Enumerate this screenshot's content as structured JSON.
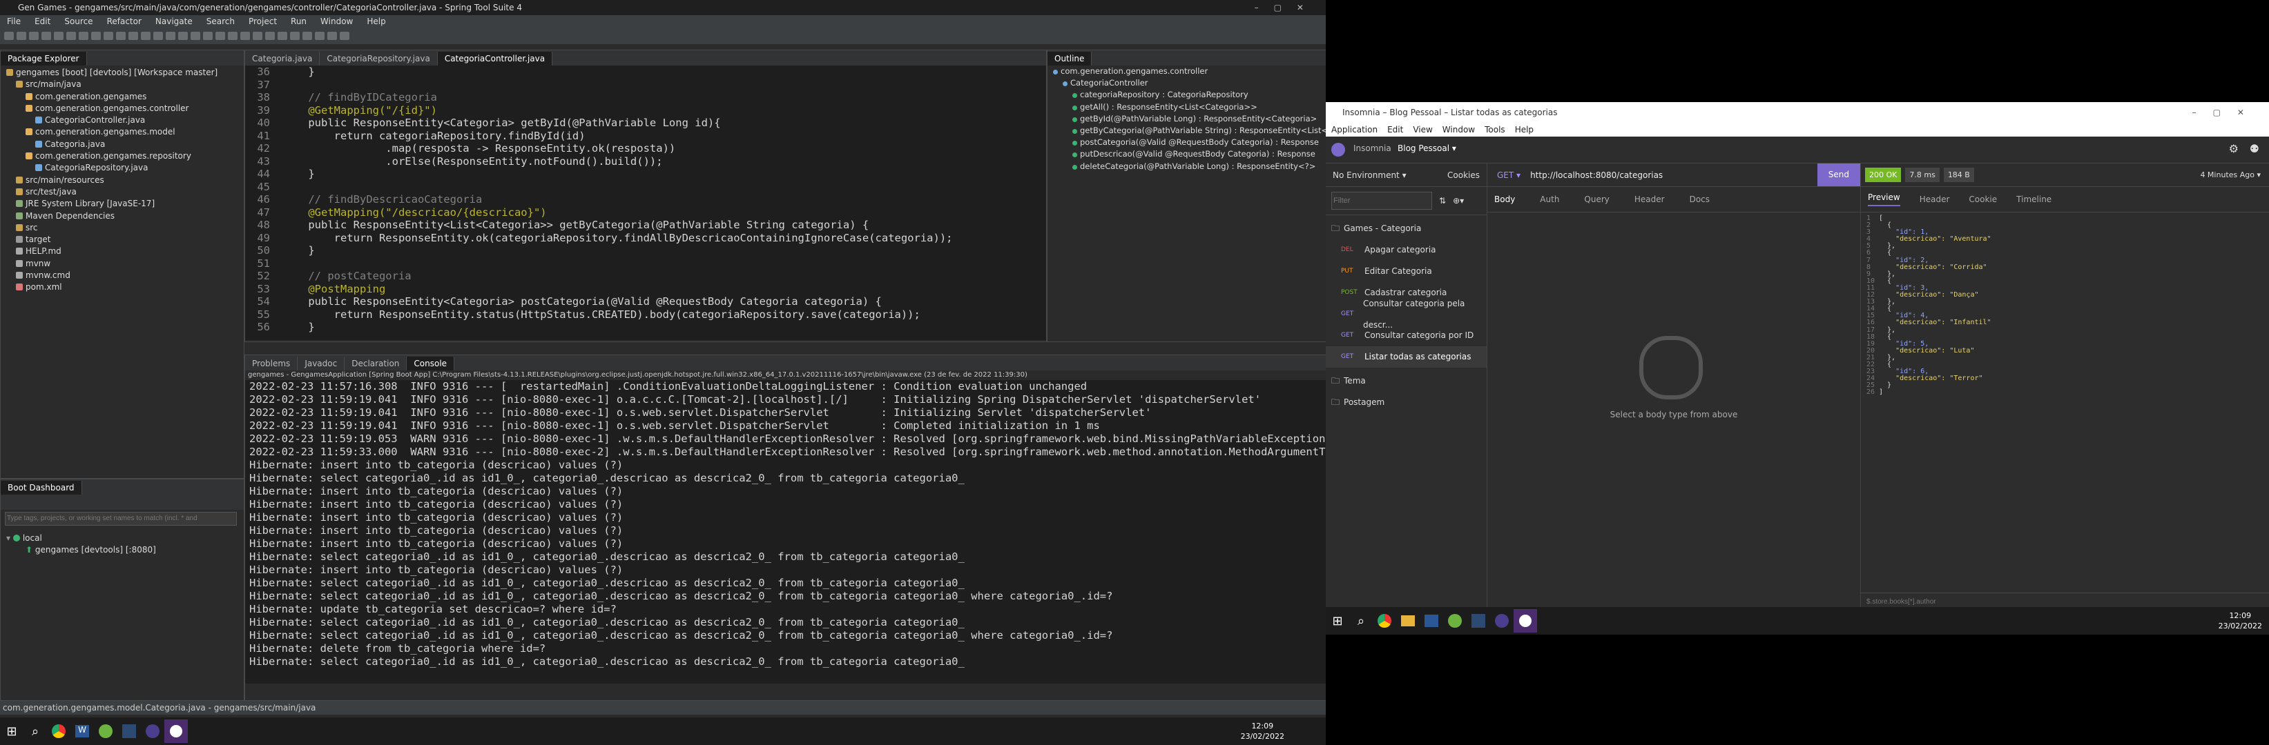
{
  "sts": {
    "title": "Gen Games - gengames/src/main/java/com/generation/gengames/controller/CategoriaController.java - Spring Tool Suite 4",
    "menu": [
      "File",
      "Edit",
      "Source",
      "Refactor",
      "Navigate",
      "Search",
      "Project",
      "Run",
      "Window",
      "Help"
    ],
    "package_explorer": {
      "tab": "Package Explorer",
      "items": [
        "gengames [boot] [devtools] [Workspace master]",
        "src/main/java",
        "com.generation.gengames",
        "com.generation.gengames.controller",
        "CategoriaController.java",
        "com.generation.gengames.model",
        "Categoria.java",
        "com.generation.gengames.repository",
        "CategoriaRepository.java",
        "src/main/resources",
        "src/test/java",
        "JRE System Library [JavaSE-17]",
        "Maven Dependencies",
        "src",
        "target",
        "HELP.md",
        "mvnw",
        "mvnw.cmd",
        "pom.xml"
      ]
    },
    "editor_tabs": [
      "Categoria.java",
      "CategoriaRepository.java",
      "CategoriaController.java"
    ],
    "code_lines": [
      {
        "n": "36",
        "t": "    }"
      },
      {
        "n": "37",
        "t": ""
      },
      {
        "n": "38",
        "t": "    // findByIDCategoria"
      },
      {
        "n": "39",
        "t": "    @GetMapping(\"/{id}\")"
      },
      {
        "n": "40",
        "t": "    public ResponseEntity<Categoria> getById(@PathVariable Long id){"
      },
      {
        "n": "41",
        "t": "        return categoriaRepository.findById(id)"
      },
      {
        "n": "42",
        "t": "                .map(resposta -> ResponseEntity.ok(resposta))"
      },
      {
        "n": "43",
        "t": "                .orElse(ResponseEntity.notFound().build());"
      },
      {
        "n": "44",
        "t": "    }"
      },
      {
        "n": "45",
        "t": ""
      },
      {
        "n": "46",
        "t": "    // findByDescricaoCategoria"
      },
      {
        "n": "47",
        "t": "    @GetMapping(\"/descricao/{descricao}\")"
      },
      {
        "n": "48",
        "t": "    public ResponseEntity<List<Categoria>> getByCategoria(@PathVariable String categoria) {"
      },
      {
        "n": "49",
        "t": "        return ResponseEntity.ok(categoriaRepository.findAllByDescricaoContainingIgnoreCase(categoria));"
      },
      {
        "n": "50",
        "t": "    }"
      },
      {
        "n": "51",
        "t": ""
      },
      {
        "n": "52",
        "t": "    // postCategoria"
      },
      {
        "n": "53",
        "t": "    @PostMapping"
      },
      {
        "n": "54",
        "t": "    public ResponseEntity<Categoria> postCategoria(@Valid @RequestBody Categoria categoria) {"
      },
      {
        "n": "55",
        "t": "        return ResponseEntity.status(HttpStatus.CREATED).body(categoriaRepository.save(categoria));"
      },
      {
        "n": "56",
        "t": "    }"
      }
    ],
    "outline": {
      "tab": "Outline",
      "items": [
        "com.generation.gengames.controller",
        "CategoriaController",
        "categoriaRepository : CategoriaRepository",
        "getAll() : ResponseEntity<List<Categoria>>",
        "getById(@PathVariable Long) : ResponseEntity<Categoria>",
        "getByCategoria(@PathVariable String) : ResponseEntity<List<",
        "postCategoria(@Valid @RequestBody Categoria) : Response",
        "putDescricao(@Valid @RequestBody Categoria) : Response",
        "deleteCategoria(@PathVariable Long) : ResponseEntity<?>"
      ]
    },
    "console_tabs": [
      "Problems",
      "Javadoc",
      "Declaration",
      "Console"
    ],
    "console_header": "gengames - GengamesApplication [Spring Boot App] C:\\Program Files\\sts-4.13.1.RELEASE\\plugins\\org.eclipse.justj.openjdk.hotspot.jre.full.win32.x86_64_17.0.1.v20211116-1657\\jre\\bin\\javaw.exe  (23 de fev. de 2022 11:39:30)",
    "console_lines": [
      "2022-02-23 11:57:16.308  INFO 9316 --- [  restartedMain] .ConditionEvaluationDeltaLoggingListener : Condition evaluation unchanged",
      "2022-02-23 11:59:19.041  INFO 9316 --- [nio-8080-exec-1] o.a.c.c.C.[Tomcat-2].[localhost].[/]     : Initializing Spring DispatcherServlet 'dispatcherServlet'",
      "2022-02-23 11:59:19.041  INFO 9316 --- [nio-8080-exec-1] o.s.web.servlet.DispatcherServlet        : Initializing Servlet 'dispatcherServlet'",
      "2022-02-23 11:59:19.041  INFO 9316 --- [nio-8080-exec-1] o.s.web.servlet.DispatcherServlet        : Completed initialization in 1 ms",
      "2022-02-23 11:59:19.053  WARN 9316 --- [nio-8080-exec-1] .w.s.m.s.DefaultHandlerExceptionResolver : Resolved [org.springframework.web.bind.MissingPathVariableException: Re",
      "2022-02-23 11:59:33.000  WARN 9316 --- [nio-8080-exec-2] .w.s.m.s.DefaultHandlerExceptionResolver : Resolved [org.springframework.web.method.annotation.MethodArgumentTypeM",
      "Hibernate: insert into tb_categoria (descricao) values (?)",
      "Hibernate: select categoria0_.id as id1_0_, categoria0_.descricao as descrica2_0_ from tb_categoria categoria0_",
      "Hibernate: insert into tb_categoria (descricao) values (?)",
      "Hibernate: insert into tb_categoria (descricao) values (?)",
      "Hibernate: insert into tb_categoria (descricao) values (?)",
      "Hibernate: insert into tb_categoria (descricao) values (?)",
      "Hibernate: insert into tb_categoria (descricao) values (?)",
      "Hibernate: select categoria0_.id as id1_0_, categoria0_.descricao as descrica2_0_ from tb_categoria categoria0_",
      "Hibernate: insert into tb_categoria (descricao) values (?)",
      "Hibernate: select categoria0_.id as id1_0_, categoria0_.descricao as descrica2_0_ from tb_categoria categoria0_",
      "Hibernate: select categoria0_.id as id1_0_, categoria0_.descricao as descrica2_0_ from tb_categoria categoria0_ where categoria0_.id=?",
      "Hibernate: update tb_categoria set descricao=? where id=?",
      "Hibernate: select categoria0_.id as id1_0_, categoria0_.descricao as descrica2_0_ from tb_categoria categoria0_",
      "Hibernate: select categoria0_.id as id1_0_, categoria0_.descricao as descrica2_0_ from tb_categoria categoria0_ where categoria0_.id=?",
      "Hibernate: delete from tb_categoria where id=?",
      "Hibernate: select categoria0_.id as id1_0_, categoria0_.descricao as descrica2_0_ from tb_categoria categoria0_"
    ],
    "boot_dashboard": {
      "tab": "Boot Dashboard",
      "filter_placeholder": "Type tags, projects, or working set names to match (incl. * and",
      "local": "local",
      "app": "gengames [devtools] [:8080]"
    },
    "status_bar": "com.generation.gengames.model.Categoria.java - gengames/src/main/java",
    "clock": {
      "time": "12:09",
      "date": "23/02/2022"
    }
  },
  "insomnia": {
    "title": "Insomnia – Blog Pessoal – Listar todas as categorias",
    "menu": [
      "Application",
      "Edit",
      "View",
      "Window",
      "Tools",
      "Help"
    ],
    "breadcrumb": {
      "app": "Insomnia",
      "collection": "Blog Pessoal"
    },
    "environment": "No Environment",
    "cookies": "Cookies",
    "filter_placeholder": "Filter",
    "folder": "Games - Categoria",
    "requests": [
      {
        "method": "DEL",
        "name": "Apagar categoria",
        "color": "#e05252"
      },
      {
        "method": "PUT",
        "name": "Editar Categoria",
        "color": "#ff9a1f"
      },
      {
        "method": "POST",
        "name": "Cadastrar categoria",
        "color": "#75ba24"
      },
      {
        "method": "GET",
        "name": "Consultar categoria pela descr...",
        "color": "#a68cff"
      },
      {
        "method": "GET",
        "name": "Consultar categoria por ID",
        "color": "#a68cff"
      },
      {
        "method": "GET",
        "name": "Listar todas as categorias",
        "color": "#a68cff"
      }
    ],
    "folders2": [
      "Tema",
      "Postagem"
    ],
    "request": {
      "method": "GET",
      "url": "http://localhost:8080/categorias",
      "send": "Send"
    },
    "request_tabs": [
      "Body",
      "Auth",
      "Query",
      "Header",
      "Docs"
    ],
    "empty_body": "Select a body type from above",
    "response": {
      "status": "200 OK",
      "time": "7.8 ms",
      "size": "184 B",
      "when": "4 Minutes Ago",
      "tabs": [
        "Preview",
        "Header",
        "Cookie",
        "Timeline"
      ],
      "filter_placeholder": "$.store.books[*].author",
      "json_lines": [
        "[",
        "  {",
        "    \"id\": 1,",
        "    \"descricao\": \"Aventura\"",
        "  },",
        "  {",
        "    \"id\": 2,",
        "    \"descricao\": \"Corrida\"",
        "  },",
        "  {",
        "    \"id\": 3,",
        "    \"descricao\": \"Dança\"",
        "  },",
        "  {",
        "    \"id\": 4,",
        "    \"descricao\": \"Infantil\"",
        "  },",
        "  {",
        "    \"id\": 5,",
        "    \"descricao\": \"Luta\"",
        "  },",
        "  {",
        "    \"id\": 6,",
        "    \"descricao\": \"Terror\"",
        "  }",
        "]"
      ]
    },
    "clock": {
      "time": "12:09",
      "date": "23/02/2022"
    }
  },
  "colors": {
    "accent": "#7d69cb",
    "send": "#7d69cb",
    "ok": "#75ba24"
  }
}
